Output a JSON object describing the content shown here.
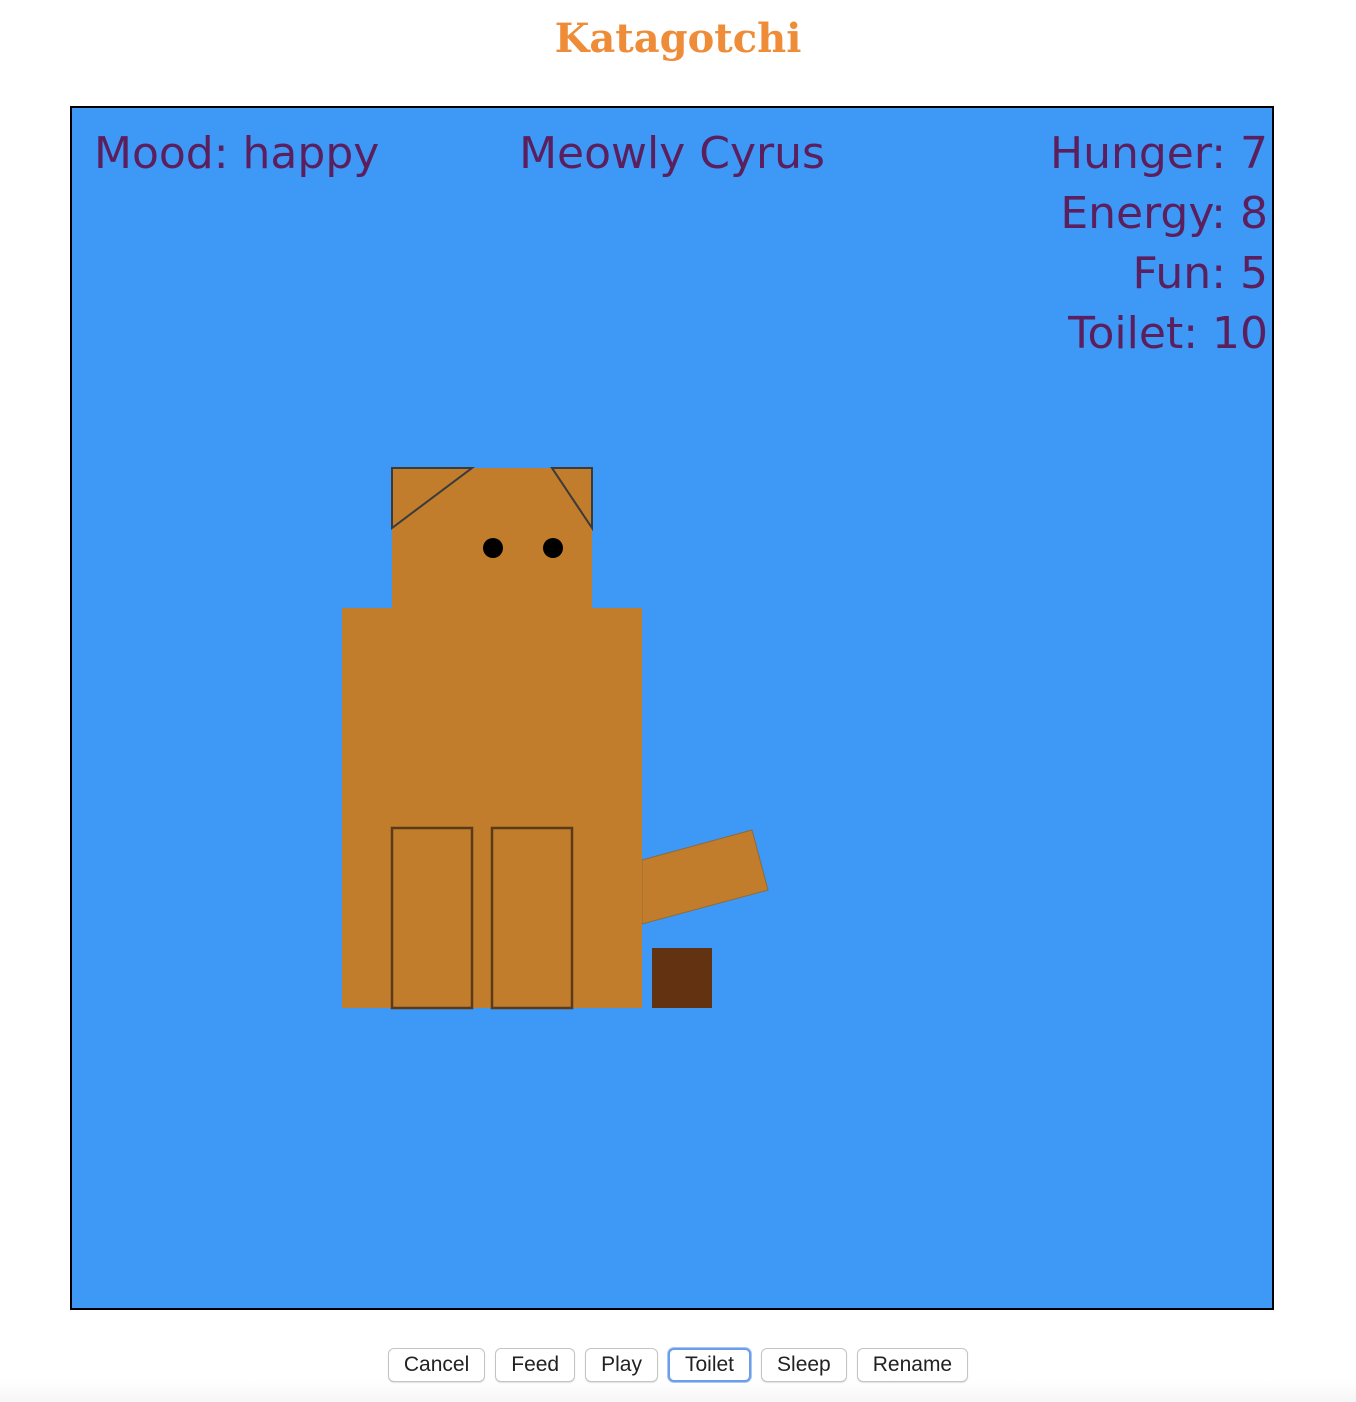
{
  "page": {
    "title": "Katagotchi"
  },
  "game": {
    "background_color": "#3d98f6",
    "mood_text": "Mood: happy",
    "pet_name": "Meowly Cyrus",
    "stats": {
      "hunger": "Hunger: 7",
      "energy": "Energy: 8",
      "fun": "Fun: 5",
      "toilet": "Toilet: 10"
    },
    "cat_color": "#c17d2b",
    "poop_color": "#633311"
  },
  "controls": {
    "cancel": "Cancel",
    "feed": "Feed",
    "play": "Play",
    "toilet": "Toilet",
    "sleep": "Sleep",
    "rename": "Rename"
  }
}
